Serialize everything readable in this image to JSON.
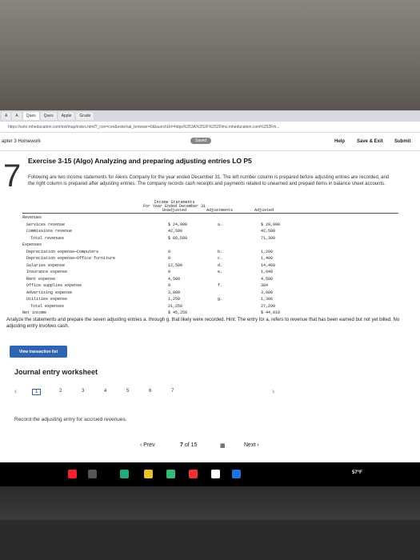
{
  "browser": {
    "tabs": [
      "A",
      "A",
      "Ques",
      "Ques",
      "Apple",
      "Grade"
    ],
    "url": "https://ezto.mheducation.com/ext/map/index.html?_con=con&external_browser=0&launchUrl=https%253A%252F%252Flms.mheducation.com%252Fm..."
  },
  "app": {
    "chapter": "apter 3 Homework",
    "saved": "Saved",
    "help": "Help",
    "save_exit": "Save & Exit",
    "submit": "Submit"
  },
  "question": {
    "number": "7",
    "title": "Exercise 3-15 (Algo) Analyzing and preparing adjusting entries LO P5",
    "instructions": "Following are two income statements for Alexis Company for the year ended December 31. The left number column is prepared before adjusting entries are recorded, and the right column is prepared after adjusting entries. The company records cash receipts and payments related to unearned and prepaid items in balance sheet accounts."
  },
  "statement": {
    "title": "Income Statements",
    "period": "For Year Ended December 31",
    "col_unadjusted": "Unadjusted",
    "col_adjustments": "Adjustments",
    "col_adjusted": "Adjusted",
    "rows": [
      {
        "label": "Revenues",
        "unadj": "",
        "adj": "",
        "adjd": "",
        "indent": 0
      },
      {
        "label": "Services revenue",
        "unadj": "$ 24,000",
        "adj": "a.",
        "adjd": "$ 28,800",
        "indent": 1
      },
      {
        "label": "Commissions revenue",
        "unadj": "42,500",
        "adj": "",
        "adjd": "42,500",
        "indent": 1
      },
      {
        "label": "Total revenues",
        "unadj": "$ 66,500",
        "adj": "",
        "adjd": "71,300",
        "indent": 2
      },
      {
        "label": "Expenses",
        "unadj": "",
        "adj": "",
        "adjd": "",
        "indent": 0
      },
      {
        "label": "Depreciation expense—Computers",
        "unadj": "0",
        "adj": "b.",
        "adjd": "1,200",
        "indent": 1
      },
      {
        "label": "Depreciation expense—Office furniture",
        "unadj": "0",
        "adj": "c.",
        "adjd": "1,400",
        "indent": 1
      },
      {
        "label": "Salaries expense",
        "unadj": "12,500",
        "adj": "d.",
        "adjd": "14,460",
        "indent": 1
      },
      {
        "label": "Insurance expense",
        "unadj": "0",
        "adj": "e.",
        "adjd": "1,040",
        "indent": 1
      },
      {
        "label": "Rent expense",
        "unadj": "4,500",
        "adj": "",
        "adjd": "4,500",
        "indent": 1
      },
      {
        "label": "Office supplies expense",
        "unadj": "0",
        "adj": "f.",
        "adjd": "384",
        "indent": 1
      },
      {
        "label": "Advertising expense",
        "unadj": "3,000",
        "adj": "",
        "adjd": "3,000",
        "indent": 1
      },
      {
        "label": "Utilities expense",
        "unadj": "1,250",
        "adj": "g.",
        "adjd": "1,306",
        "indent": 1
      },
      {
        "label": "Total expenses",
        "unadj": "21,250",
        "adj": "",
        "adjd": "27,290",
        "indent": 2
      },
      {
        "label": "Net income",
        "unadj": "$ 45,250",
        "adj": "",
        "adjd": "$ 44,010",
        "indent": 0
      }
    ]
  },
  "analyze": "Analyze the statements and prepare the seven adjusting entries a. through g. that likely were recorded. Hint: The entry for a. refers to revenue that has been earned but not yet billed. No adjusting entry involves cash.",
  "view_transaction_list": "View transaction list",
  "worksheet": {
    "title": "Journal entry worksheet",
    "steps": [
      "1",
      "2",
      "3",
      "4",
      "5",
      "6",
      "7"
    ],
    "prompt": "Record the adjusting entry for accrued revenues."
  },
  "nav": {
    "prev": "‹ Prev",
    "page": "7",
    "of": "of 15",
    "next": "Next ›"
  },
  "taskbar": {
    "weather": "57°F"
  }
}
